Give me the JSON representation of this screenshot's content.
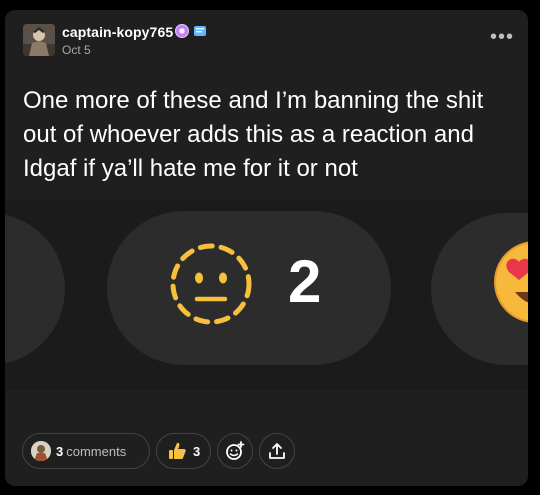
{
  "post": {
    "username": "captain-kopy765",
    "date": "Oct 5",
    "text": "One more of these and I’m banning the shit out of whoever adds this as a reaction and Idgaf if ya’ll hate me for it or not",
    "more_label": "•••"
  },
  "media": {
    "reaction_count": "2",
    "reaction_emoji": "dotted-line-face",
    "neighbor_emoji": "heart-eyes"
  },
  "footer": {
    "comments_count": "3",
    "comments_word": "comments",
    "likes_count": "3",
    "likes_icon": "thumbs-up",
    "add_reaction_icon": "smiley-plus",
    "share_icon": "share-upload"
  },
  "colors": {
    "card_bg": "#1f1f1f",
    "pill_bg": "#2c2c2c",
    "emoji_yellow": "#f7c03c"
  }
}
